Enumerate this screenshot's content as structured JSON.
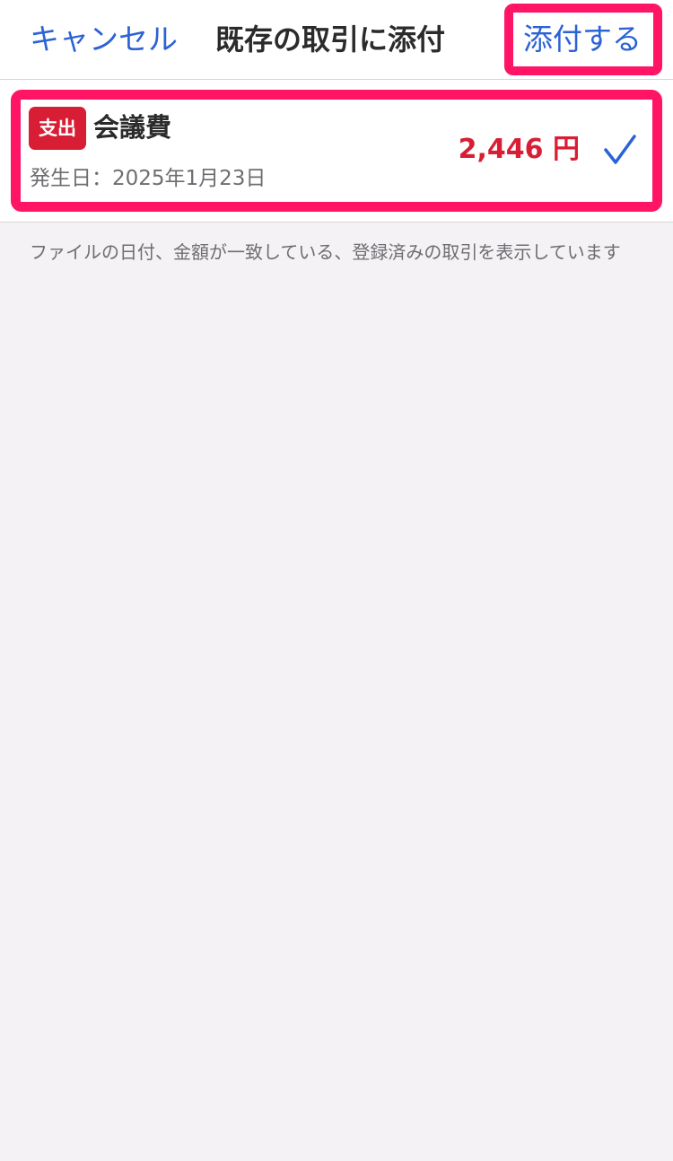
{
  "nav": {
    "cancel_label": "キャンセル",
    "title": "既存の取引に添付",
    "attach_label": "添付する"
  },
  "transaction": {
    "badge": "支出",
    "name": "会議費",
    "date": "発生日：2025年1月23日",
    "amount": "2,446 円",
    "selected": true,
    "check_icon": "checkmark-icon"
  },
  "footnote": "ファイルの日付、金額が一致している、登録済みの取引を表示しています",
  "colors": {
    "accent": "#2c62d6",
    "expense": "#d81e34",
    "highlight": "#ff1466",
    "background": "#f4f2f4"
  }
}
